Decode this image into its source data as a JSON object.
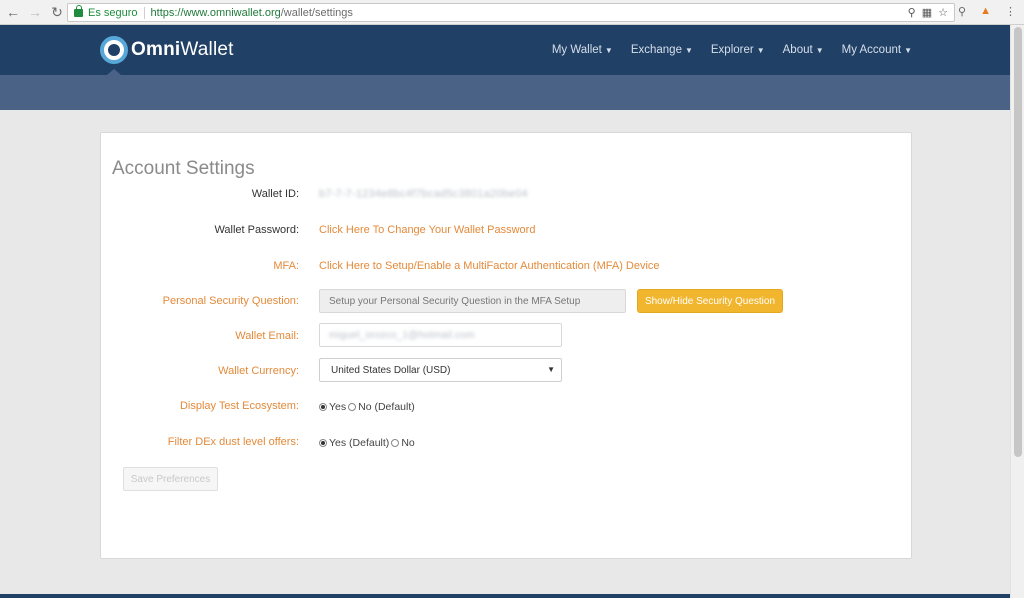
{
  "browser": {
    "secure_label": "Es seguro",
    "url_main": "https://www.omniwallet.org",
    "url_path": "/wallet/settings"
  },
  "header": {
    "logo_bold": "Omni",
    "logo_regular": "Wallet",
    "nav": [
      "My Wallet",
      "Exchange",
      "Explorer",
      "About",
      "My Account"
    ]
  },
  "settings": {
    "title": "Account Settings",
    "wallet_id_label": "Wallet ID:",
    "wallet_id_value": "b7-7-7-1234e8bc4f7bcad5c3801a20be04",
    "wallet_password_label": "Wallet Password:",
    "wallet_password_link": "Click Here To Change Your Wallet Password",
    "mfa_label": "MFA:",
    "mfa_link": "Click Here to Setup/Enable a MultiFactor Authentication (MFA) Device",
    "security_question_label": "Personal Security Question:",
    "security_question_placeholder": "Setup your Personal Security Question in the MFA Setup",
    "show_hide_button": "Show/Hide Security Question",
    "wallet_email_label": "Wallet Email:",
    "wallet_email_value": "miguel_orozco_1@hotmail.com",
    "wallet_currency_label": "Wallet Currency:",
    "wallet_currency_value": "United States Dollar (USD)",
    "display_test_label": "Display Test Ecosystem:",
    "display_test_yes": "Yes",
    "display_test_no": "No (Default)",
    "filter_dex_label": "Filter DEx dust level offers:",
    "filter_dex_yes": "Yes (Default)",
    "filter_dex_no": "No",
    "save_button": "Save Preferences"
  },
  "colors": {
    "header_bg": "#214066",
    "banner_bg": "#4b6287",
    "accent_orange": "#e38a3a",
    "button_yellow": "#f1b52e"
  }
}
